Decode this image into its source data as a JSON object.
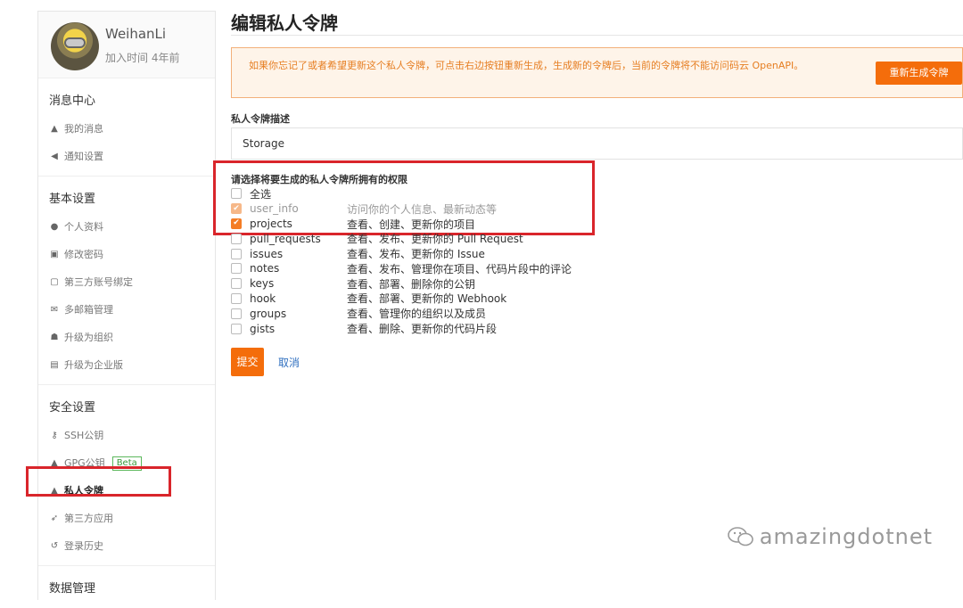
{
  "sidebar": {
    "username": "WeihanLi",
    "joined": "加入时间 4年前",
    "sections": [
      {
        "title": "消息中心",
        "items": [
          {
            "icon": "bell-icon",
            "glyph": "▲",
            "label": "我的消息"
          },
          {
            "icon": "speaker-icon",
            "glyph": "◀",
            "label": "通知设置"
          }
        ]
      },
      {
        "title": "基本设置",
        "items": [
          {
            "icon": "user-icon",
            "glyph": "●",
            "label": "个人资料"
          },
          {
            "icon": "unlock-icon",
            "glyph": "▣",
            "label": "修改密码"
          },
          {
            "icon": "id-card-icon",
            "glyph": "▢",
            "label": "第三方账号绑定"
          },
          {
            "icon": "envelope-icon",
            "glyph": "✉",
            "label": "多邮箱管理"
          },
          {
            "icon": "group-icon",
            "glyph": "☗",
            "label": "升级为组织"
          },
          {
            "icon": "building-icon",
            "glyph": "▤",
            "label": "升级为企业版"
          }
        ]
      },
      {
        "title": "安全设置",
        "items": [
          {
            "icon": "key-icon",
            "glyph": "⚷",
            "label": "SSH公钥"
          },
          {
            "icon": "lock-icon",
            "glyph": "▲",
            "label": "GPG公钥",
            "badge": "Beta"
          },
          {
            "icon": "token-icon",
            "glyph": "▲",
            "label": "私人令牌",
            "active": true
          },
          {
            "icon": "rocket-icon",
            "glyph": "➶",
            "label": "第三方应用"
          },
          {
            "icon": "history-icon",
            "glyph": "↺",
            "label": "登录历史"
          }
        ]
      },
      {
        "title": "数据管理",
        "items": []
      }
    ]
  },
  "main": {
    "title": "编辑私人令牌",
    "warning": "如果你忘记了或者希望更新这个私人令牌，可点击右边按钮重新生成，生成新的令牌后，当前的令牌将不能访问码云 OpenAPI。",
    "regen_button": "重新生成令牌",
    "desc_label": "私人令牌描述",
    "desc_value": "Storage",
    "perm_label": "请选择将要生成的私人令牌所拥有的权限",
    "select_all": "全选",
    "permissions": [
      {
        "name": "user_info",
        "desc": "访问你的个人信息、最新动态等",
        "checked": true,
        "disabled": true
      },
      {
        "name": "projects",
        "desc": "查看、创建、更新你的项目",
        "checked": true,
        "disabled": false
      },
      {
        "name": "pull_requests",
        "desc": "查看、发布、更新你的 Pull Request",
        "checked": false
      },
      {
        "name": "issues",
        "desc": "查看、发布、更新你的 Issue",
        "checked": false
      },
      {
        "name": "notes",
        "desc": "查看、发布、管理你在项目、代码片段中的评论",
        "checked": false
      },
      {
        "name": "keys",
        "desc": "查看、部署、删除你的公钥",
        "checked": false
      },
      {
        "name": "hook",
        "desc": "查看、部署、更新你的 Webhook",
        "checked": false
      },
      {
        "name": "groups",
        "desc": "查看、管理你的组织以及成员",
        "checked": false
      },
      {
        "name": "gists",
        "desc": "查看、删除、更新你的代码片段",
        "checked": false
      }
    ],
    "submit": "提交",
    "cancel": "取消"
  },
  "watermark": "amazingdotnet",
  "colors": {
    "accent": "#f46d0b",
    "highlight": "#d9252b",
    "link": "#2f6fbf"
  }
}
